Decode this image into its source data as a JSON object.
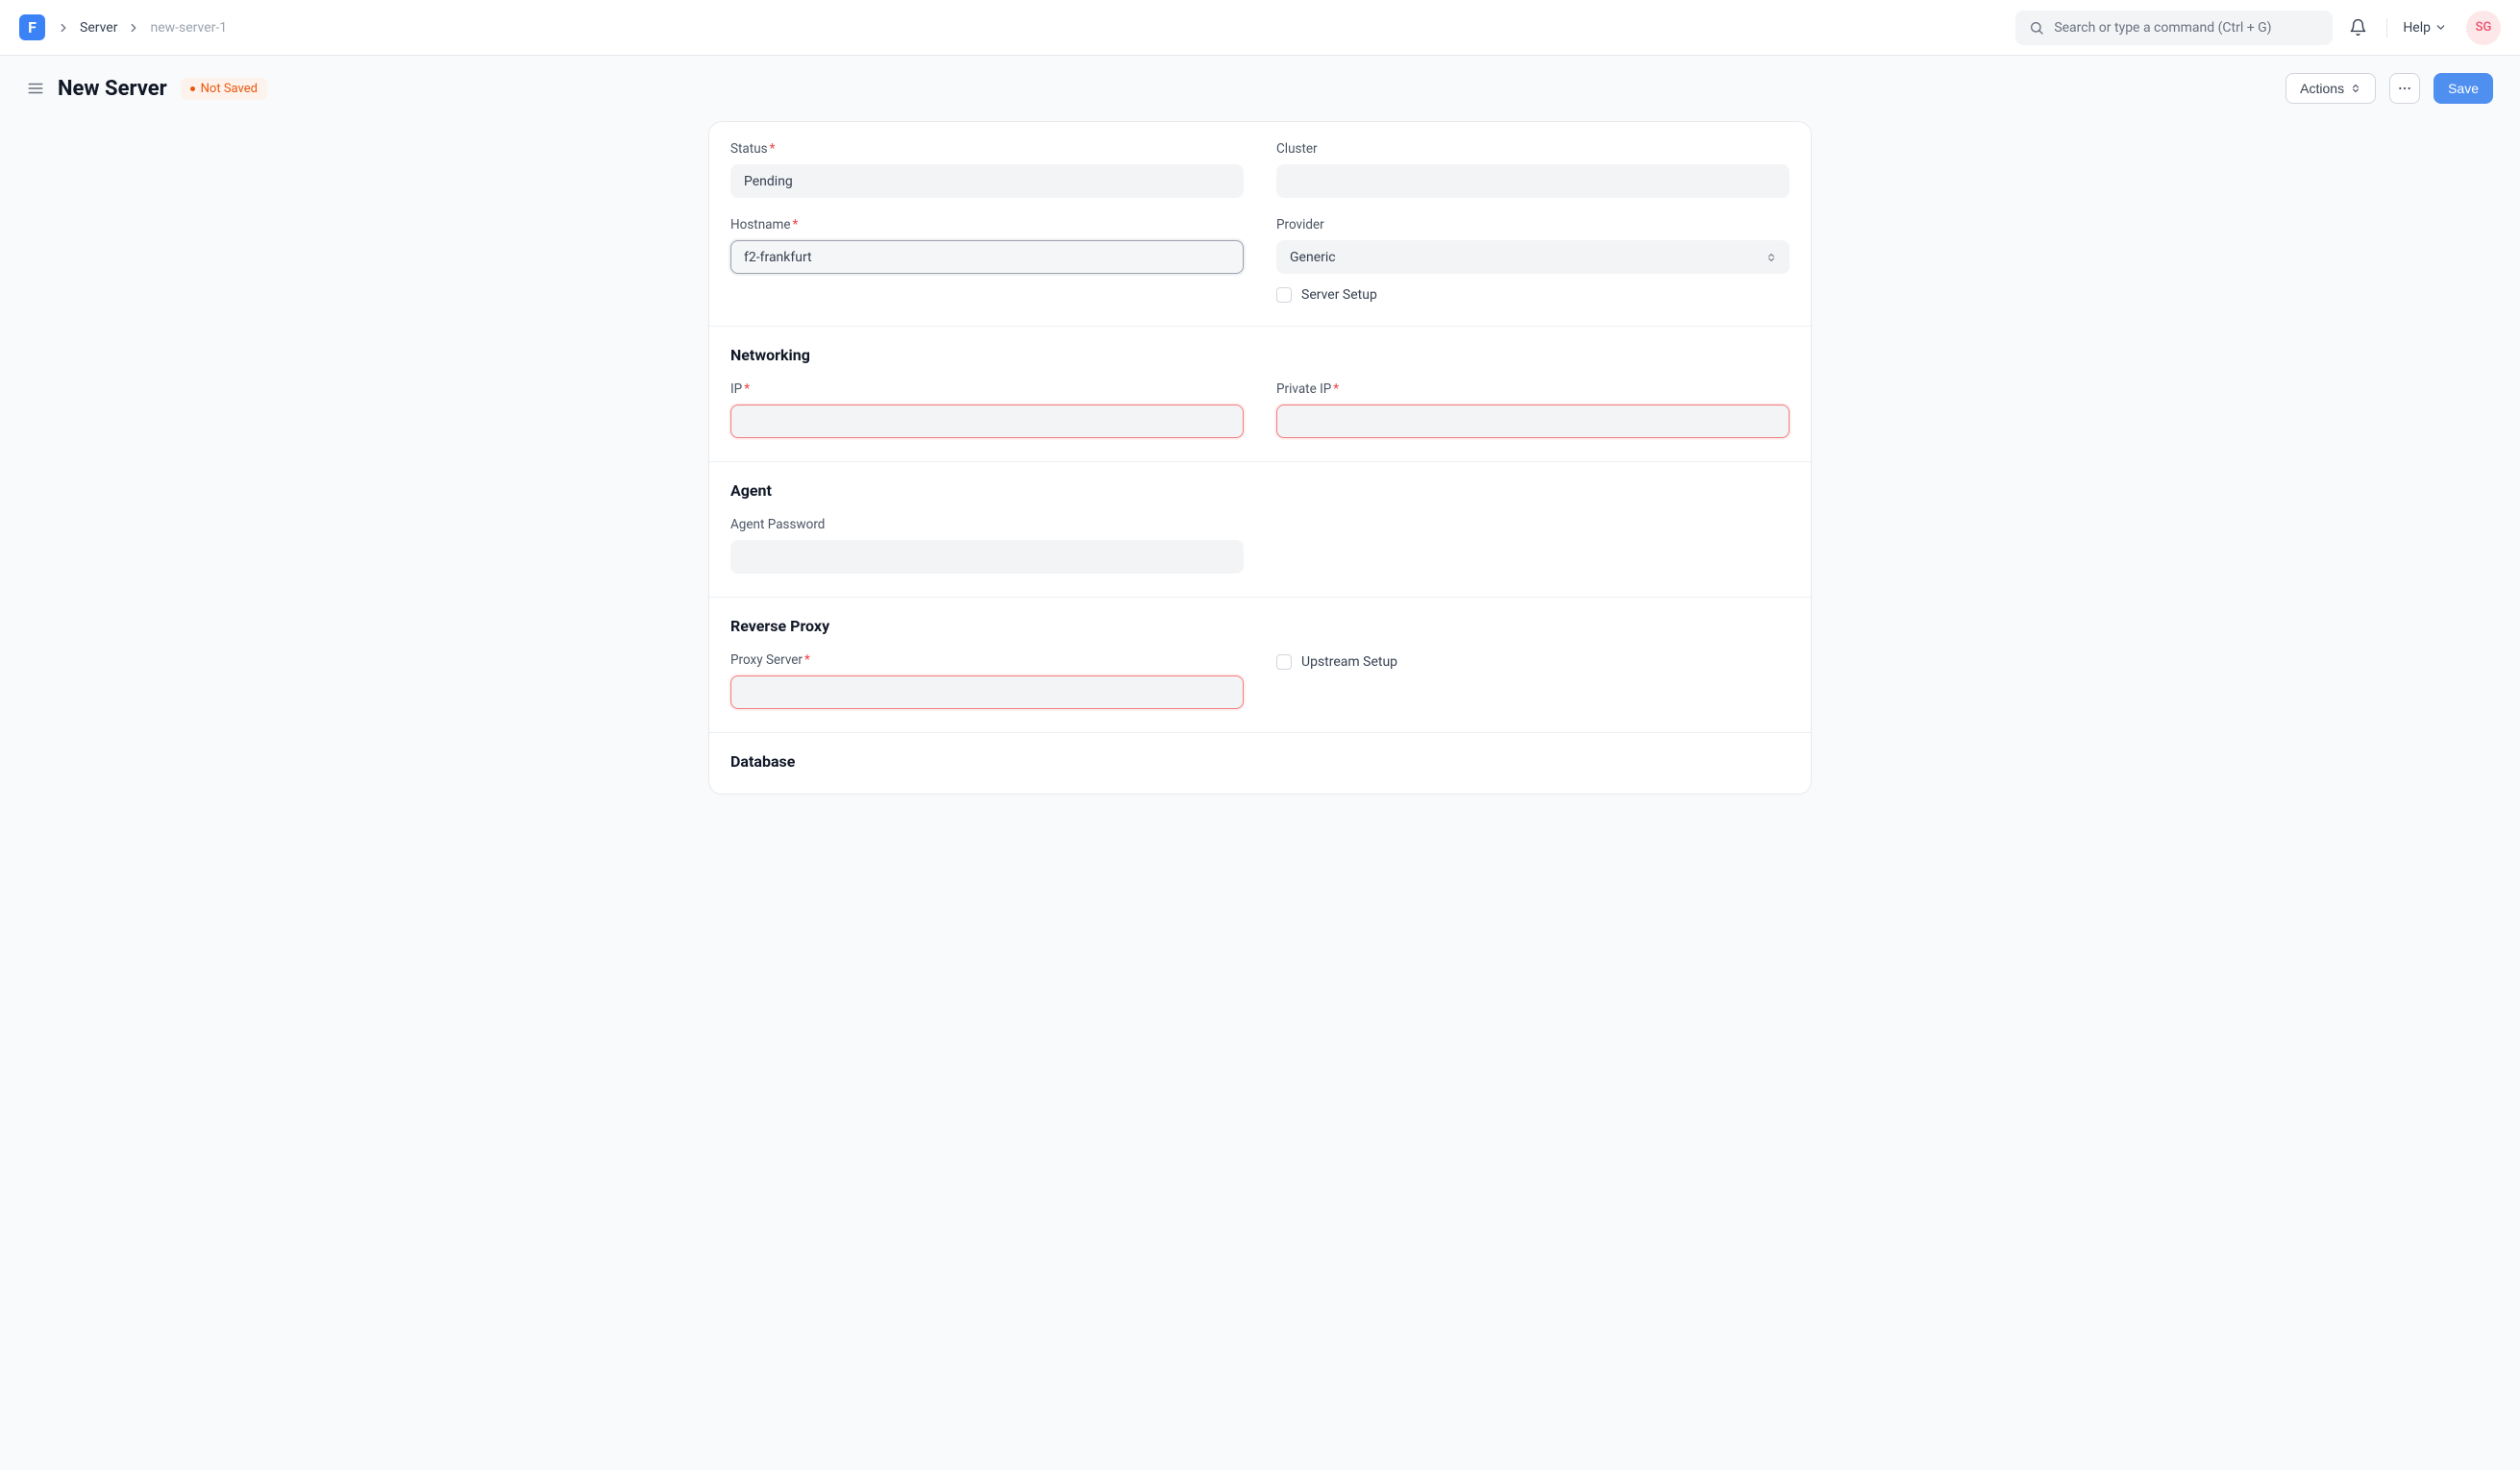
{
  "navbar": {
    "logo_letter": "F",
    "breadcrumbs": {
      "parent": "Server",
      "current": "new-server-1"
    },
    "search_placeholder": "Search or type a command (Ctrl + G)",
    "help_label": "Help",
    "avatar_initials": "SG"
  },
  "header": {
    "title": "New Server",
    "status_pill": "Not Saved",
    "actions_label": "Actions",
    "save_label": "Save"
  },
  "form": {
    "top": {
      "status_label": "Status",
      "status_value": "Pending",
      "cluster_label": "Cluster",
      "cluster_value": "",
      "hostname_label": "Hostname",
      "hostname_value": "f2-frankfurt",
      "provider_label": "Provider",
      "provider_value": "Generic",
      "server_setup_label": "Server Setup"
    },
    "networking": {
      "title": "Networking",
      "ip_label": "IP",
      "ip_value": "",
      "private_ip_label": "Private IP",
      "private_ip_value": ""
    },
    "agent": {
      "title": "Agent",
      "agent_password_label": "Agent Password",
      "agent_password_value": ""
    },
    "reverse_proxy": {
      "title": "Reverse Proxy",
      "proxy_server_label": "Proxy Server",
      "proxy_server_value": "",
      "upstream_setup_label": "Upstream Setup"
    },
    "database": {
      "title": "Database"
    }
  }
}
